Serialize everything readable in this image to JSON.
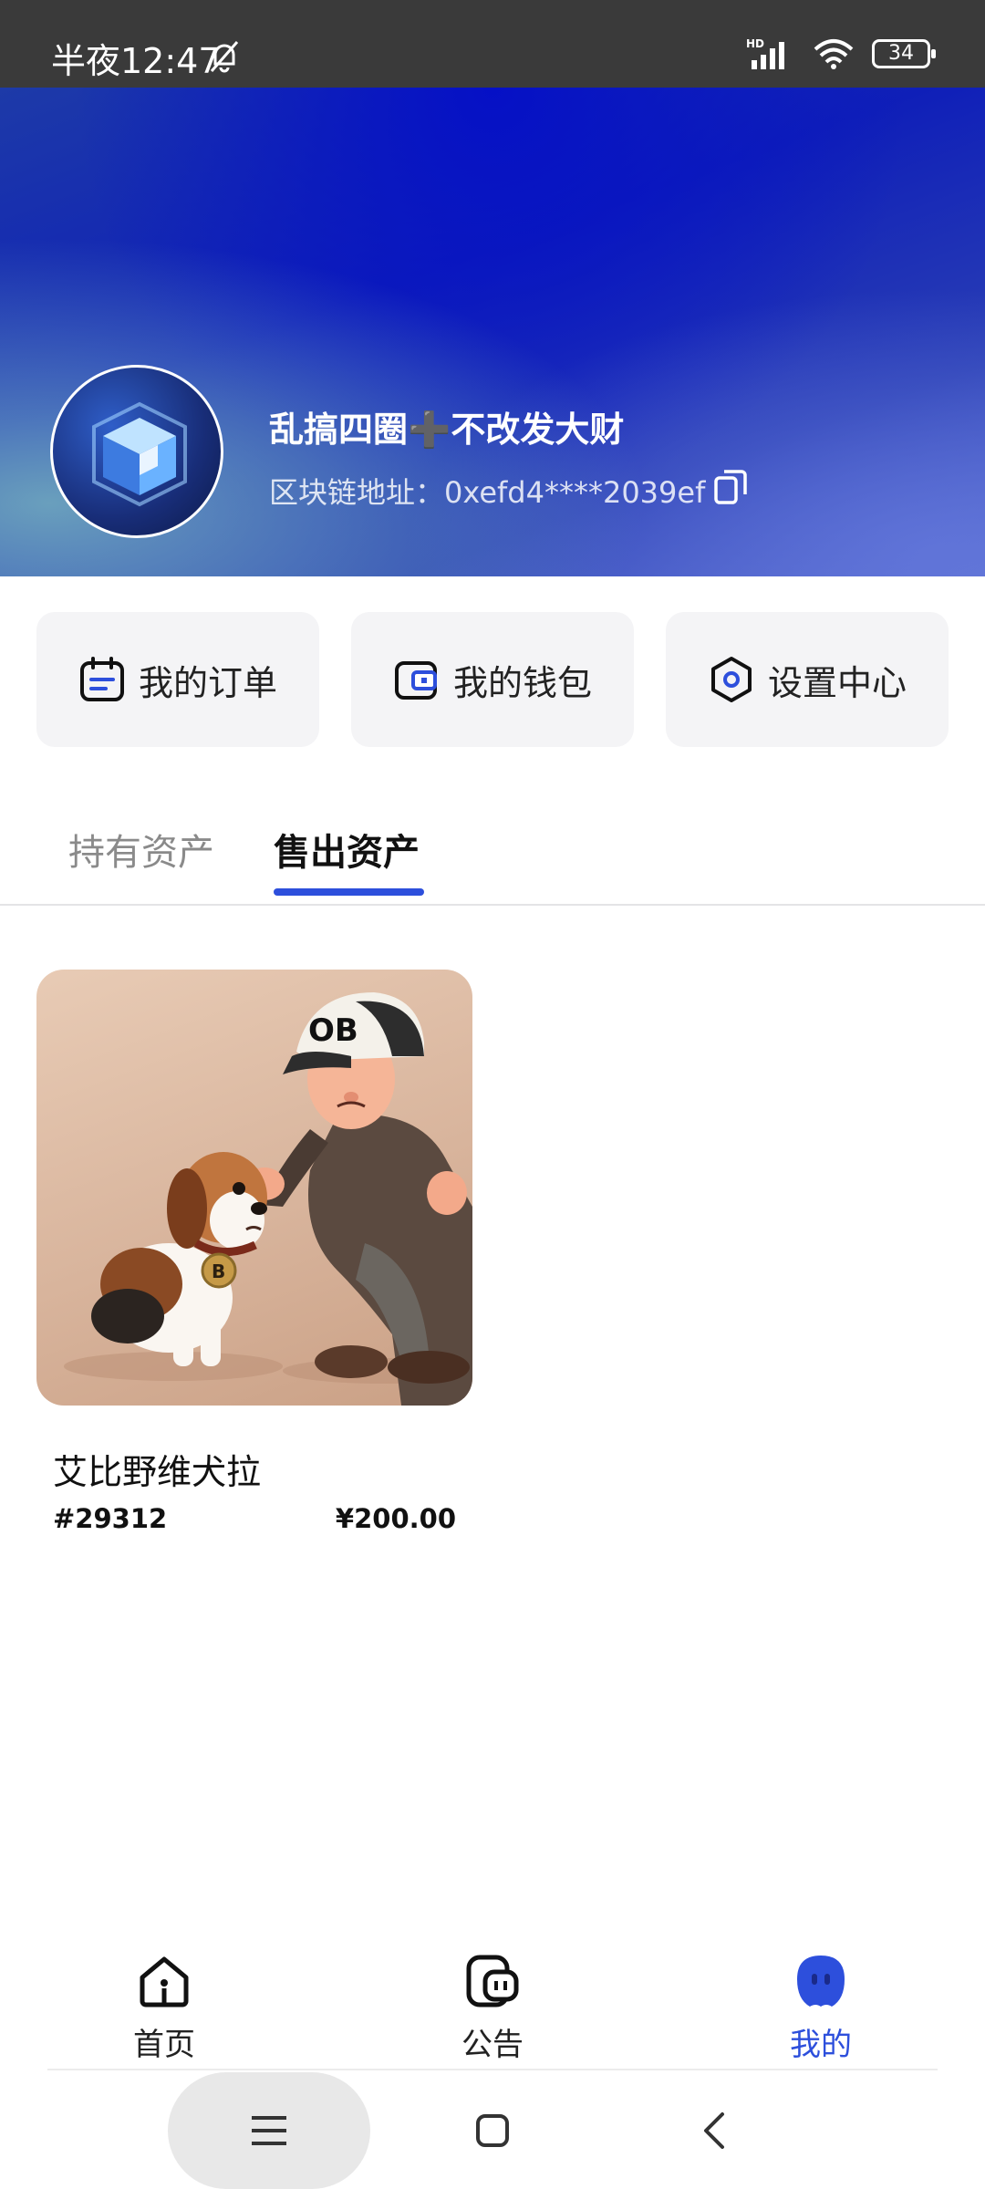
{
  "status_bar": {
    "time": "半夜12:47",
    "battery": "34",
    "network": "HD"
  },
  "profile": {
    "name": "乱搞四圈➕不改发大财",
    "address_label": "区块链地址：",
    "address": "0xefd4****2039ef"
  },
  "actions": [
    {
      "label": "我的订单",
      "icon": "calendar-icon"
    },
    {
      "label": "我的钱包",
      "icon": "wallet-icon"
    },
    {
      "label": "设置中心",
      "icon": "hexagon-settings-icon"
    }
  ],
  "tabs": [
    {
      "label": "持有资产",
      "active": false
    },
    {
      "label": "售出资产",
      "active": true
    }
  ],
  "assets": [
    {
      "title": "艾比野维犬拉",
      "id": "#29312",
      "price": "¥200.00",
      "image_badge": "OB",
      "tag": "B"
    }
  ],
  "bottom_nav": [
    {
      "label": "首页",
      "icon": "home-icon",
      "active": false
    },
    {
      "label": "公告",
      "icon": "announcement-icon",
      "active": false
    },
    {
      "label": "我的",
      "icon": "profile-icon",
      "active": true
    }
  ],
  "colors": {
    "accent": "#2d4fdc",
    "header_dark": "#0f1fb8",
    "status_bar": "#3a3a3a"
  }
}
